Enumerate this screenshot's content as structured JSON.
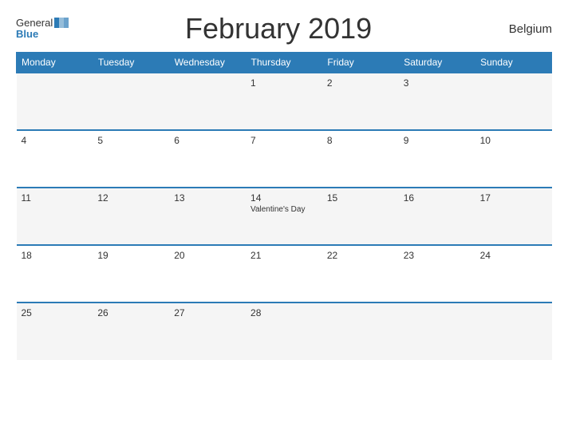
{
  "header": {
    "logo_general": "General",
    "logo_blue": "Blue",
    "title": "February 2019",
    "country": "Belgium"
  },
  "calendar": {
    "days_of_week": [
      "Monday",
      "Tuesday",
      "Wednesday",
      "Thursday",
      "Friday",
      "Saturday",
      "Sunday"
    ],
    "weeks": [
      [
        {
          "date": "",
          "event": ""
        },
        {
          "date": "",
          "event": ""
        },
        {
          "date": "",
          "event": ""
        },
        {
          "date": "1",
          "event": ""
        },
        {
          "date": "2",
          "event": ""
        },
        {
          "date": "3",
          "event": ""
        },
        {
          "date": "",
          "event": ""
        }
      ],
      [
        {
          "date": "4",
          "event": ""
        },
        {
          "date": "5",
          "event": ""
        },
        {
          "date": "6",
          "event": ""
        },
        {
          "date": "7",
          "event": ""
        },
        {
          "date": "8",
          "event": ""
        },
        {
          "date": "9",
          "event": ""
        },
        {
          "date": "10",
          "event": ""
        }
      ],
      [
        {
          "date": "11",
          "event": ""
        },
        {
          "date": "12",
          "event": ""
        },
        {
          "date": "13",
          "event": ""
        },
        {
          "date": "14",
          "event": "Valentine's Day"
        },
        {
          "date": "15",
          "event": ""
        },
        {
          "date": "16",
          "event": ""
        },
        {
          "date": "17",
          "event": ""
        }
      ],
      [
        {
          "date": "18",
          "event": ""
        },
        {
          "date": "19",
          "event": ""
        },
        {
          "date": "20",
          "event": ""
        },
        {
          "date": "21",
          "event": ""
        },
        {
          "date": "22",
          "event": ""
        },
        {
          "date": "23",
          "event": ""
        },
        {
          "date": "24",
          "event": ""
        }
      ],
      [
        {
          "date": "25",
          "event": ""
        },
        {
          "date": "26",
          "event": ""
        },
        {
          "date": "27",
          "event": ""
        },
        {
          "date": "28",
          "event": ""
        },
        {
          "date": "",
          "event": ""
        },
        {
          "date": "",
          "event": ""
        },
        {
          "date": "",
          "event": ""
        }
      ]
    ]
  }
}
